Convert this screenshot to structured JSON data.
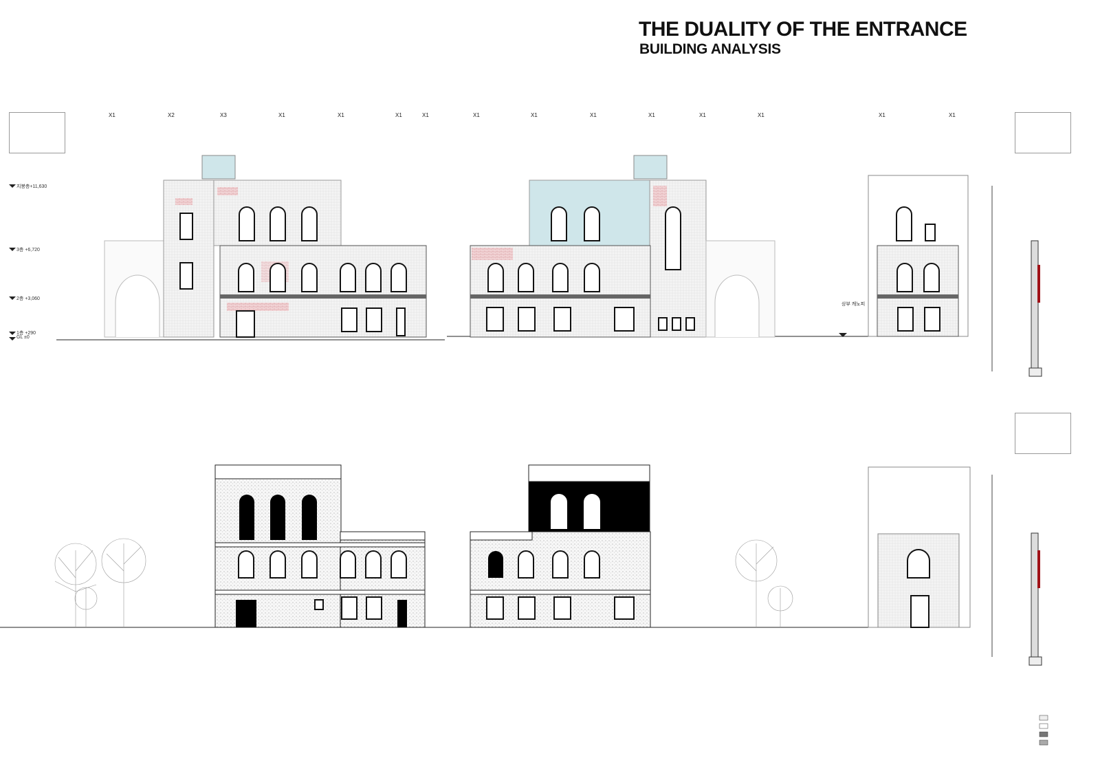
{
  "header": {
    "title": "THE DUALITY OF THE ENTRANCE",
    "subtitle": "BUILDING ANALYSIS"
  },
  "levels": [
    {
      "label": "지붕층+11,630"
    },
    {
      "label": "3층 +6,720"
    },
    {
      "label": "2층 +3,060"
    },
    {
      "label": "1층 +290"
    },
    {
      "label": "GL ±0"
    }
  ],
  "gridlines": [
    "X1",
    "X2",
    "X3",
    "X1",
    "X1",
    "X1",
    "X1",
    "X1",
    "X1",
    "X1",
    "X1",
    "X1",
    "X1",
    "X1",
    "X1"
  ],
  "annotations": {
    "canopy": "상부 캐노피"
  },
  "colors": {
    "brick": "#e7b3b7",
    "glass": "#cfe6ea",
    "line": "#222222"
  }
}
